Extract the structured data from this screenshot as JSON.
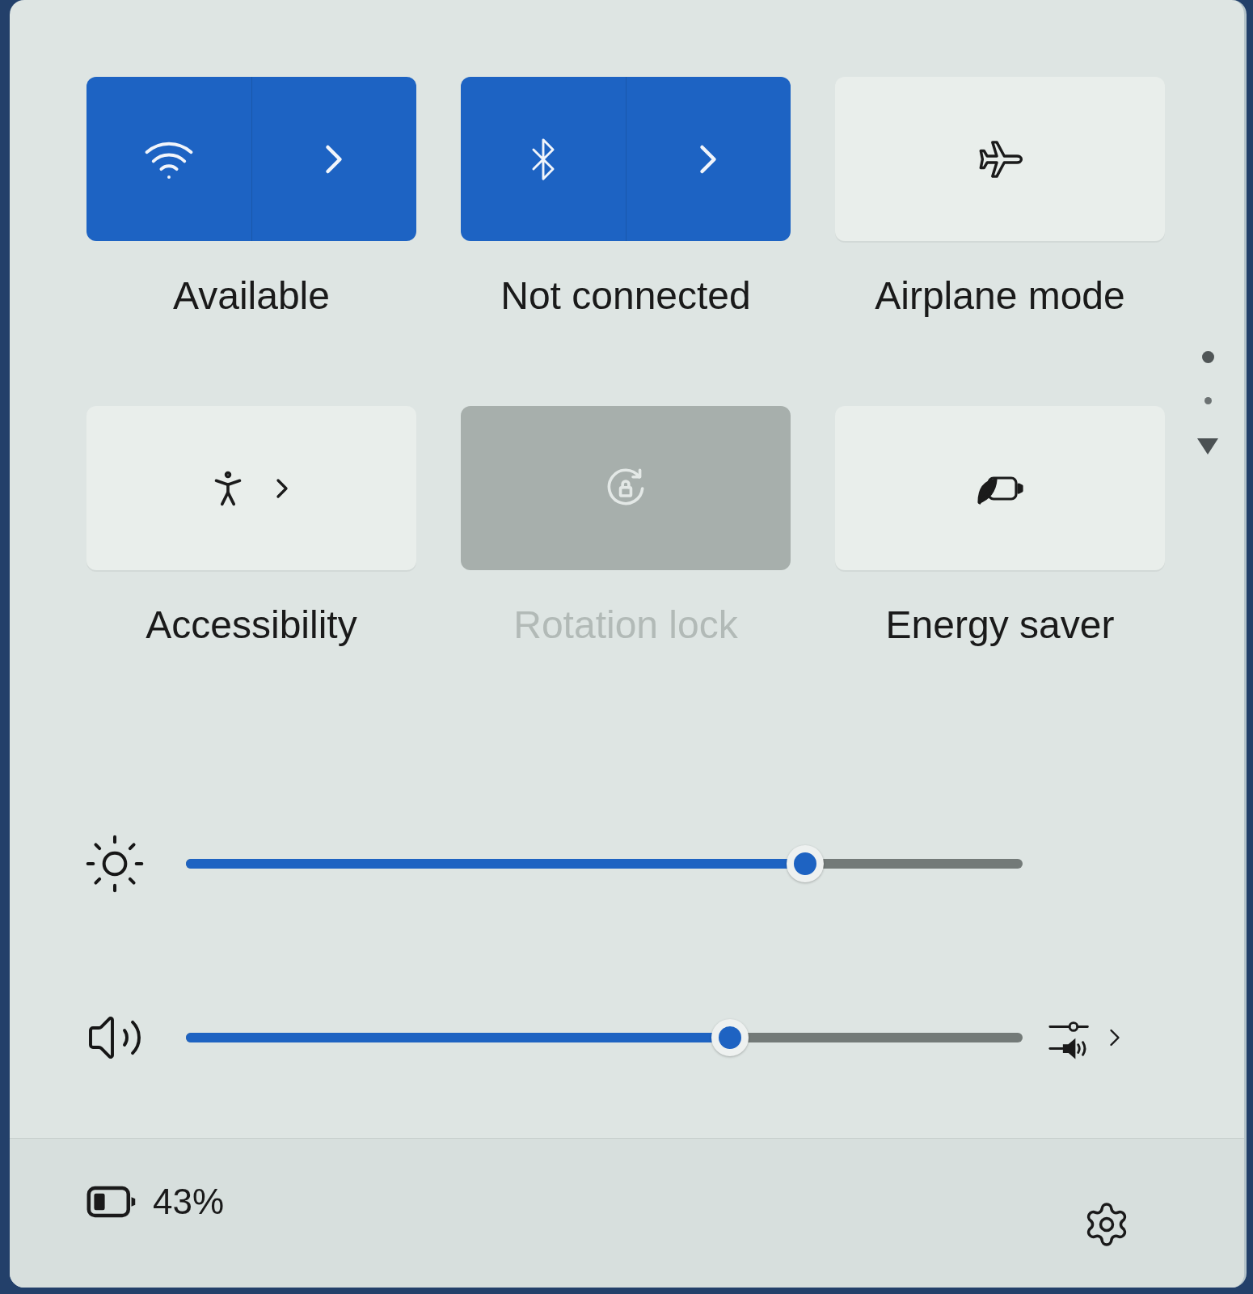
{
  "tiles": [
    {
      "kind": "split",
      "label": "Available",
      "on": true,
      "disabled": false
    },
    {
      "kind": "split",
      "label": "Not connected",
      "on": true,
      "disabled": false
    },
    {
      "kind": "toggle",
      "label": "Airplane mode",
      "on": false,
      "disabled": false
    },
    {
      "kind": "expand",
      "label": "Accessibility",
      "on": false,
      "disabled": false
    },
    {
      "kind": "toggle",
      "label": "Rotation lock",
      "on": false,
      "disabled": true
    },
    {
      "kind": "toggle",
      "label": "Energy saver",
      "on": false,
      "disabled": false
    }
  ],
  "pages": [
    {
      "selected": true
    },
    {
      "selected": false
    }
  ],
  "sliders": [
    {
      "level": 0.74,
      "menu": false
    },
    {
      "level": 0.65,
      "menu": true
    }
  ],
  "battery": {
    "text": "43%"
  }
}
